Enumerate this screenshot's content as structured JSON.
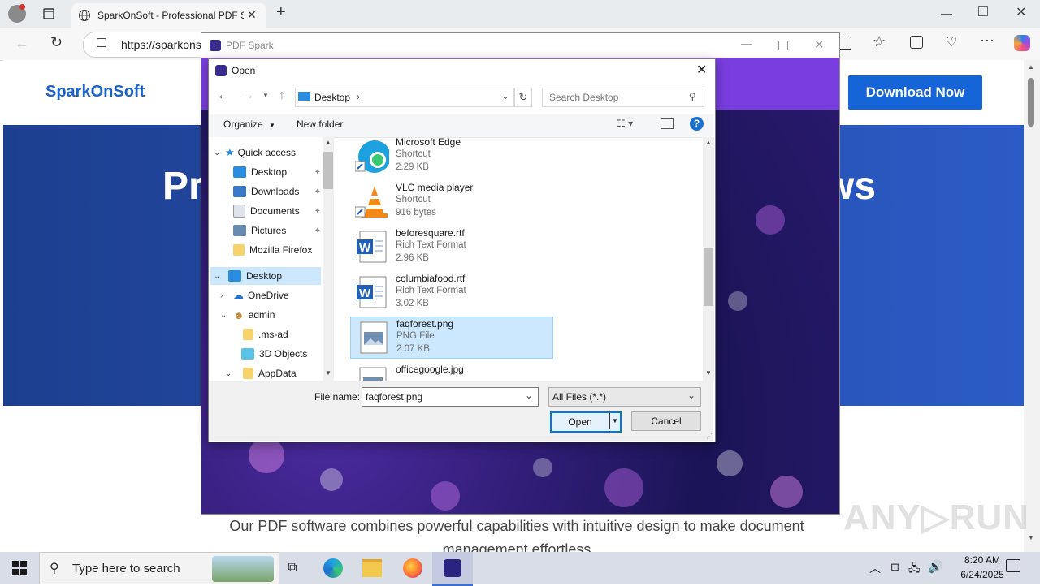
{
  "browser": {
    "tab_title": "SparkOnSoft - Professional PDF S",
    "url": "https://sparkons",
    "window_controls": [
      "minimize",
      "restore",
      "close"
    ]
  },
  "page": {
    "brand": "SparkOnSoft",
    "download_button": "Download Now",
    "hero_left": "Pr",
    "hero_right": "ws",
    "description": "Our PDF software combines powerful capabilities with intuitive design to make document management effortless"
  },
  "spark_window": {
    "title": "PDF Spark"
  },
  "dialog": {
    "title": "Open",
    "breadcrumb": "Desktop",
    "search_placeholder": "Search Desktop",
    "organize_label": "Organize",
    "new_folder_label": "New folder",
    "nav": [
      {
        "label": "Quick access",
        "icon": "star-icon"
      },
      {
        "label": "Desktop",
        "icon": "desktop-icon",
        "pinned": true
      },
      {
        "label": "Downloads",
        "icon": "download-icon",
        "pinned": true
      },
      {
        "label": "Documents",
        "icon": "documents-icon",
        "pinned": true
      },
      {
        "label": "Pictures",
        "icon": "pictures-icon",
        "pinned": true
      },
      {
        "label": "Mozilla Firefox",
        "icon": "folder-icon"
      },
      {
        "label": "Desktop",
        "icon": "desktop-icon",
        "selected": true
      },
      {
        "label": "OneDrive",
        "icon": "cloud-icon"
      },
      {
        "label": "admin",
        "icon": "user-icon"
      },
      {
        "label": ".ms-ad",
        "icon": "folder-icon"
      },
      {
        "label": "3D Objects",
        "icon": "cube-icon"
      },
      {
        "label": "AppData",
        "icon": "folder-icon"
      }
    ],
    "files": [
      {
        "name": "Microsoft Edge",
        "type": "Shortcut",
        "size": "2.29 KB",
        "icon": "edge-icon"
      },
      {
        "name": "VLC media player",
        "type": "Shortcut",
        "size": "916 bytes",
        "icon": "vlc-icon"
      },
      {
        "name": "beforesquare.rtf",
        "type": "Rich Text Format",
        "size": "2.96 KB",
        "icon": "word-doc-icon"
      },
      {
        "name": "columbiafood.rtf",
        "type": "Rich Text Format",
        "size": "3.02 KB",
        "icon": "word-doc-icon"
      },
      {
        "name": "faqforest.png",
        "type": "PNG File",
        "size": "2.07 KB",
        "icon": "image-file-icon",
        "selected": true
      },
      {
        "name": "officegoogle.jpg",
        "type": "",
        "size": "",
        "icon": "image-file-icon"
      }
    ],
    "file_name_label": "File name:",
    "file_name_value": "faqforest.png",
    "filter_value": "All Files (*.*)",
    "open_label": "Open",
    "cancel_label": "Cancel"
  },
  "taskbar": {
    "search_placeholder": "Type here to search",
    "time": "8:20 AM",
    "date": "6/24/2025"
  },
  "watermark": "ANY RUN"
}
